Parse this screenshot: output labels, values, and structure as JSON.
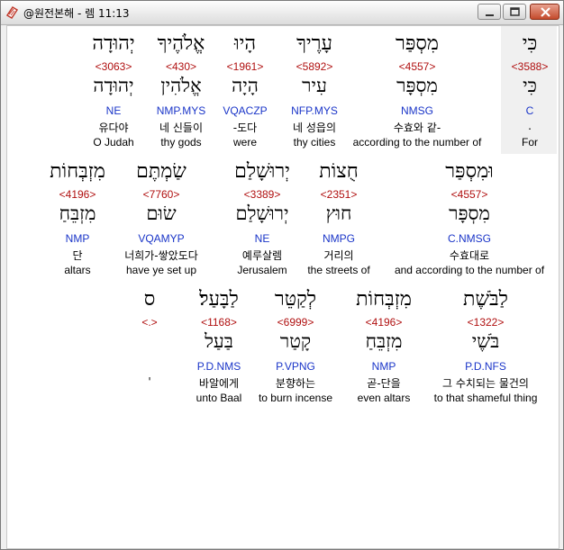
{
  "window": {
    "title": "@원전본해 - 렘 11:13",
    "app_icon": "bible-book-icon",
    "controls": [
      "minimize-icon",
      "maximize-icon",
      "close-icon"
    ],
    "close_color": "#c44b2c"
  },
  "colors": {
    "strong": "#b01010",
    "morph": "#1a35c8",
    "text": "#000000",
    "highlight_bg": "#f0f0f0"
  },
  "rows": [
    {
      "words": [
        {
          "heb": "כִּי",
          "strong": "<3588>",
          "lex": "כִּי",
          "morph": "C",
          "kor": ".",
          "eng": "For"
        },
        {
          "heb": "מִסְפַּר",
          "strong": "<4557>",
          "lex": "מִסְפָּר",
          "morph": "NMSG",
          "kor": "수효와 같-",
          "eng": "according to the number of"
        },
        {
          "heb": "עָרֶיךָ",
          "strong": "<5892>",
          "lex": "עִיר",
          "morph": "NFP.MYS",
          "kor": "네 성읍의",
          "eng": "thy cities"
        },
        {
          "heb": "הָיוּ",
          "strong": "<1961>",
          "lex": "הָיָה",
          "morph": "VQACZP",
          "kor": "-도다",
          "eng": "were"
        },
        {
          "heb": "אֱלֹהֶיךָ",
          "strong": "<430>",
          "lex": "אֱלֹהִין",
          "morph": "NMP.MYS",
          "kor": "네 신들이",
          "eng": "thy gods"
        },
        {
          "heb": "יְהוּדָה",
          "strong": "<3063>",
          "lex": "יְהוּדָה",
          "morph": "NE",
          "kor": "유다야",
          "eng": "O Judah"
        }
      ]
    },
    {
      "words": [
        {
          "heb": "וּמִסְפַּר",
          "strong": "<4557>",
          "lex": "מִסְפָּר",
          "morph": "C.NMSG",
          "kor": "수효대로",
          "eng": "and according to the number of"
        },
        {
          "heb": "חֻצוֹת",
          "strong": "<2351>",
          "lex": "חוּץ",
          "morph": "NMPG",
          "kor": "거리의",
          "eng": "the streets of"
        },
        {
          "heb": "יְרוּשָׁלַם",
          "strong": "<3389>",
          "lex": "יְרוּשָׁלַם",
          "morph": "NE",
          "kor": "예루살렘",
          "eng": "Jerusalem"
        },
        {
          "heb": "שַׂמְתֶּם",
          "strong": "<7760>",
          "lex": "שׂוּם",
          "morph": "VQAMYP",
          "kor": "너희가-쌓았도다",
          "eng": "have ye set up"
        },
        {
          "heb": "מִזְבְּחוֹת",
          "strong": "<4196>",
          "lex": "מִזְבֵּחַ",
          "morph": "NMP",
          "kor": "단",
          "eng": "altars"
        }
      ]
    },
    {
      "words": [
        {
          "heb": "לַבֹּשֶׁת",
          "strong": "<1322>",
          "lex": "בֹּשֶׁי",
          "morph": "P.D.NFS",
          "kor": "그 수치되는 물건의",
          "eng": "to that shameful thing"
        },
        {
          "heb": "מִזְבְּחוֹת",
          "strong": "<4196>",
          "lex": "מִזְבֵּחַ",
          "morph": "NMP",
          "kor": "곧-단을",
          "eng": "even altars"
        },
        {
          "heb": "לְקַטֵּר",
          "strong": "<6999>",
          "lex": "קָטַר",
          "morph": "P.VPNG",
          "kor": "분향하는",
          "eng": "to burn incense"
        },
        {
          "heb": "לַבָּעַל׃",
          "strong": "<1168>",
          "lex": "בַּעַל",
          "morph": "P.D.NMS",
          "kor": "바알에게",
          "eng": "unto Baal"
        },
        {
          "heb": "ס",
          "strong": "<.>",
          "lex": "",
          "morph": "",
          "kor": "'",
          "eng": ""
        }
      ]
    }
  ]
}
